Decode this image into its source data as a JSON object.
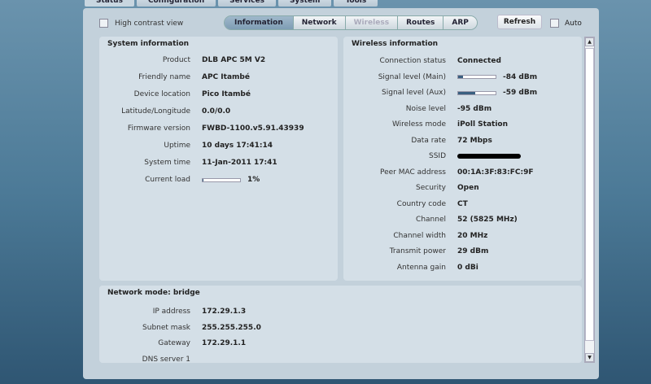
{
  "top_tabs": [
    "Status",
    "Configuration",
    "Services",
    "System",
    "Tools"
  ],
  "high_contrast_label": "High contrast view",
  "sub_tabs": [
    {
      "label": "Information",
      "active": true
    },
    {
      "label": "Network"
    },
    {
      "label": "Wireless",
      "disabled": true
    },
    {
      "label": "Routes"
    },
    {
      "label": "ARP"
    }
  ],
  "refresh_label": "Refresh",
  "auto_label": "Auto",
  "system": {
    "title": "System information",
    "rows": [
      {
        "label": "Product",
        "value": "DLB APC 5M V2"
      },
      {
        "label": "Friendly name",
        "value": "APC Itambé"
      },
      {
        "label": "Device location",
        "value": "Pico Itambé"
      },
      {
        "label": "Latitude/Longitude",
        "value": "0.0/0.0"
      },
      {
        "label": "Firmware version",
        "value": "FWBD-1100.v5.91.43939"
      },
      {
        "label": "Uptime",
        "value": "10 days 17:41:14"
      },
      {
        "label": "System time",
        "value": "11-Jan-2011 17:41"
      },
      {
        "label": "Current load",
        "value": "1%",
        "bar_percent": 1
      }
    ]
  },
  "wireless": {
    "title": "Wireless information",
    "rows": [
      {
        "label": "Connection status",
        "value": "Connected"
      },
      {
        "label": "Signal level (Main)",
        "value": "-84 dBm",
        "bar_percent": 12
      },
      {
        "label": "Signal level (Aux)",
        "value": "-59 dBm",
        "bar_percent": 45
      },
      {
        "label": "Noise level",
        "value": "-95 dBm"
      },
      {
        "label": "Wireless mode",
        "value": "iPoll Station"
      },
      {
        "label": "Data rate",
        "value": "72 Mbps"
      },
      {
        "label": "SSID",
        "value": "",
        "redacted": true
      },
      {
        "label": "Peer MAC address",
        "value": "00:1A:3F:83:FC:9F"
      },
      {
        "label": "Security",
        "value": "Open"
      },
      {
        "label": "Country code",
        "value": "CT"
      },
      {
        "label": "Channel",
        "value": "52 (5825 MHz)"
      },
      {
        "label": "Channel width",
        "value": "20 MHz"
      },
      {
        "label": "Transmit power",
        "value": "29 dBm"
      },
      {
        "label": "Antenna gain",
        "value": "0 dBi"
      }
    ]
  },
  "network": {
    "title": "Network mode: bridge",
    "rows": [
      {
        "label": "IP address",
        "value": "172.29.1.3"
      },
      {
        "label": "Subnet mask",
        "value": "255.255.255.0"
      },
      {
        "label": "Gateway",
        "value": "172.29.1.1"
      },
      {
        "label": "DNS server 1",
        "value": ""
      }
    ]
  }
}
